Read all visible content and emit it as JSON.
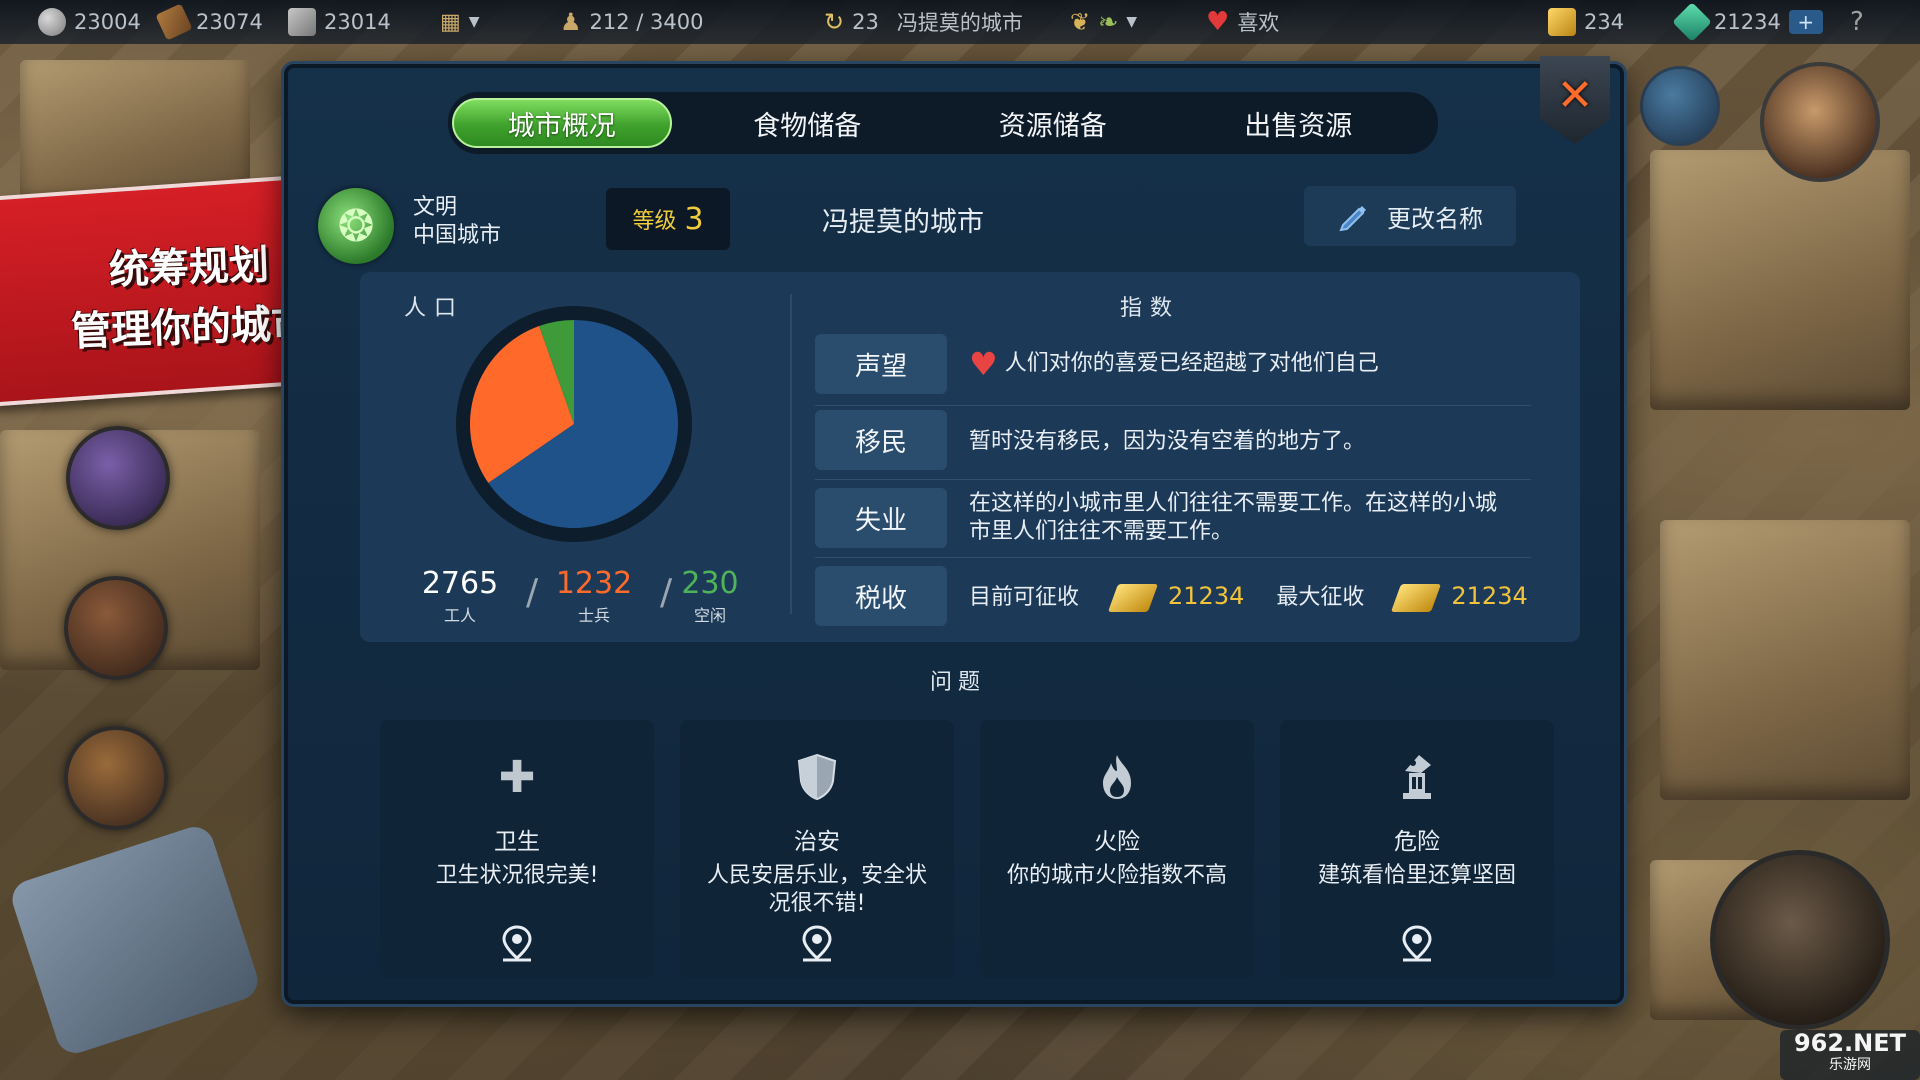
{
  "topbar": {
    "coins": "23004",
    "wood": "23074",
    "stone": "23014",
    "population": "212 / 3400",
    "turn": "23",
    "city": "冯提莫的城市",
    "mood": "喜欢",
    "gold": "234",
    "gems": "21234",
    "plus": "+",
    "help": "?"
  },
  "banner": {
    "line1": "统筹规划",
    "line2": "管理你的城市"
  },
  "tabs": [
    {
      "label": "城市概况",
      "active": true
    },
    {
      "label": "食物储备",
      "active": false
    },
    {
      "label": "资源储备",
      "active": false
    },
    {
      "label": "出售资源",
      "active": false
    }
  ],
  "header": {
    "civ_title": "文明",
    "civ_name": "中国城市",
    "level_label": "等级",
    "level_value": "3",
    "city_name": "冯提莫的城市",
    "rename_label": "更改名称"
  },
  "population": {
    "title": "人口",
    "workers": {
      "value": "2765",
      "label": "工人",
      "color": "#1f5289"
    },
    "soldiers": {
      "value": "1232",
      "label": "士兵",
      "color": "#ff6a2b"
    },
    "idle": {
      "value": "230",
      "label": "空闲",
      "color": "#3f9a3a"
    },
    "chart_data": {
      "type": "pie",
      "categories": [
        "工人",
        "士兵",
        "空闲"
      ],
      "values": [
        2765,
        1232,
        230
      ]
    }
  },
  "indices": {
    "title": "指数",
    "reputation": {
      "tag": "声望",
      "text": "人们对你的喜爱已经超越了对他们自己"
    },
    "immigration": {
      "tag": "移民",
      "text": "暂时没有移民，因为没有空着的地方了。"
    },
    "unemployment": {
      "tag": "失业",
      "text": "在这样的小城市里人们往往不需要工作。在这样的小城市里人们往往不需要工作。"
    },
    "tax": {
      "tag": "税收",
      "current_label": "目前可征收",
      "current_value": "21234",
      "max_label": "最大征收",
      "max_value": "21234"
    }
  },
  "problems": {
    "title": "问题",
    "items": [
      {
        "title": "卫生",
        "desc": "卫生状况很完美!",
        "icon": "plus-icon",
        "locate": true
      },
      {
        "title": "治安",
        "desc": "人民安居乐业，安全状况很不错!",
        "icon": "shield-icon",
        "locate": true
      },
      {
        "title": "火险",
        "desc": "你的城市火险指数不高",
        "icon": "fire-icon",
        "locate": false
      },
      {
        "title": "危险",
        "desc": "建筑看恰里还算坚固",
        "icon": "ruins-icon",
        "locate": true
      }
    ]
  },
  "watermark": {
    "top": "962.NET",
    "bottom": "乐游网"
  }
}
